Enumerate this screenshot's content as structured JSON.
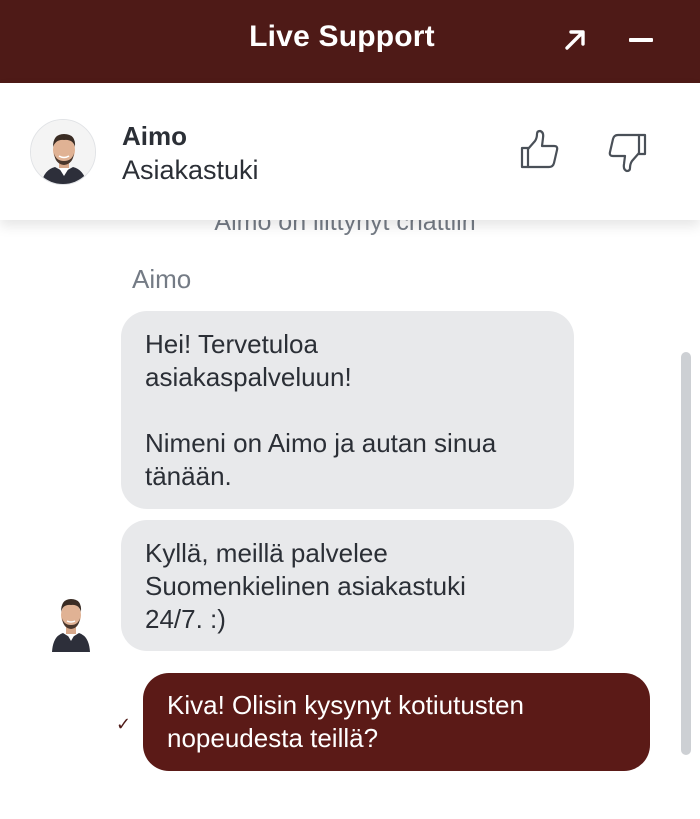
{
  "window": {
    "title": "Live Support"
  },
  "agent": {
    "name": "Aimo",
    "role": "Asiakastuki"
  },
  "conversation": {
    "system_note": "Aimo on liittynyt chattiin",
    "sender_label": "Aimo",
    "messages": [
      {
        "direction": "incoming",
        "lines": [
          "Hei! Tervetuloa",
          "asiakaspalveluun!",
          "",
          "Nimeni on Aimo ja autan sinua",
          "tänään."
        ]
      },
      {
        "direction": "incoming",
        "lines": [
          "Kyllä, meillä palvelee",
          "Suomenkielinen asiakastuki",
          "24/7. :)"
        ]
      },
      {
        "direction": "outgoing",
        "lines": [
          "Kiva! Olisin kysynyt kotiutusten",
          "nopeudesta teillä?"
        ],
        "status": "✓"
      }
    ]
  },
  "icons": {
    "expand": "expand-arrow-icon",
    "minimize": "minimize-icon",
    "thumbs_up": "thumbs-up-icon",
    "thumbs_down": "thumbs-down-icon",
    "sent_check": "check-icon"
  },
  "colors": {
    "brand": "#4e1a17",
    "outgoing_bubble": "#5b1a17",
    "incoming_bubble": "#e8e9eb",
    "muted_text": "#747b85"
  }
}
